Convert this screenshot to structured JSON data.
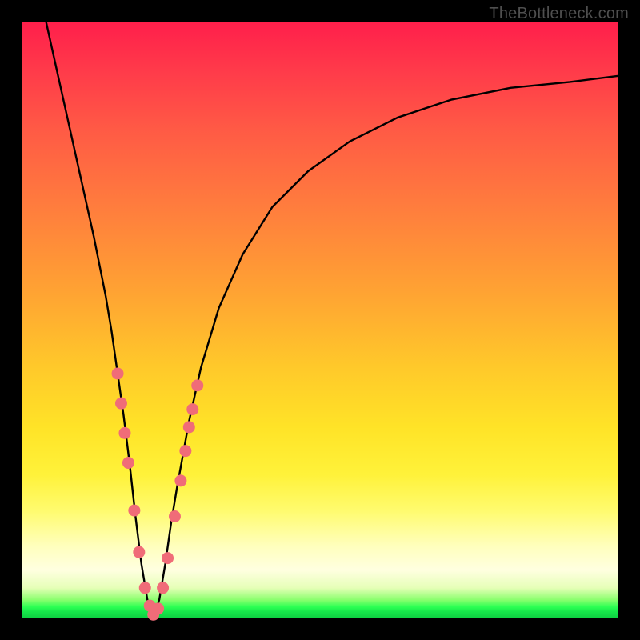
{
  "watermark": "TheBottleneck.com",
  "chart_data": {
    "type": "line",
    "title": "",
    "xlabel": "",
    "ylabel": "",
    "xlim": [
      0,
      100
    ],
    "ylim": [
      0,
      100
    ],
    "grid": false,
    "legend": false,
    "notch_x": 22,
    "series": [
      {
        "name": "bottleneck-curve",
        "x": [
          4,
          6,
          8,
          10,
          12,
          14,
          15,
          16,
          17,
          18,
          19,
          20,
          21,
          22,
          23,
          24,
          25,
          26,
          28,
          30,
          33,
          37,
          42,
          48,
          55,
          63,
          72,
          82,
          92,
          100
        ],
        "y": [
          100,
          91,
          82,
          73,
          64,
          54,
          48,
          41,
          34,
          26,
          17,
          9,
          3,
          0,
          3,
          9,
          16,
          22,
          33,
          42,
          52,
          61,
          69,
          75,
          80,
          84,
          87,
          89,
          90,
          91
        ]
      }
    ],
    "markers": {
      "name": "highlight-dots",
      "color": "#f06c78",
      "points": [
        {
          "x": 16.0,
          "y": 41
        },
        {
          "x": 16.6,
          "y": 36
        },
        {
          "x": 17.2,
          "y": 31
        },
        {
          "x": 17.8,
          "y": 26
        },
        {
          "x": 18.8,
          "y": 18
        },
        {
          "x": 19.6,
          "y": 11
        },
        {
          "x": 20.6,
          "y": 5
        },
        {
          "x": 21.4,
          "y": 2
        },
        {
          "x": 22.0,
          "y": 0.5
        },
        {
          "x": 22.8,
          "y": 1.5
        },
        {
          "x": 23.6,
          "y": 5
        },
        {
          "x": 24.4,
          "y": 10
        },
        {
          "x": 25.6,
          "y": 17
        },
        {
          "x": 26.6,
          "y": 23
        },
        {
          "x": 27.4,
          "y": 28
        },
        {
          "x": 28.0,
          "y": 32
        },
        {
          "x": 28.6,
          "y": 35
        },
        {
          "x": 29.4,
          "y": 39
        }
      ]
    }
  }
}
